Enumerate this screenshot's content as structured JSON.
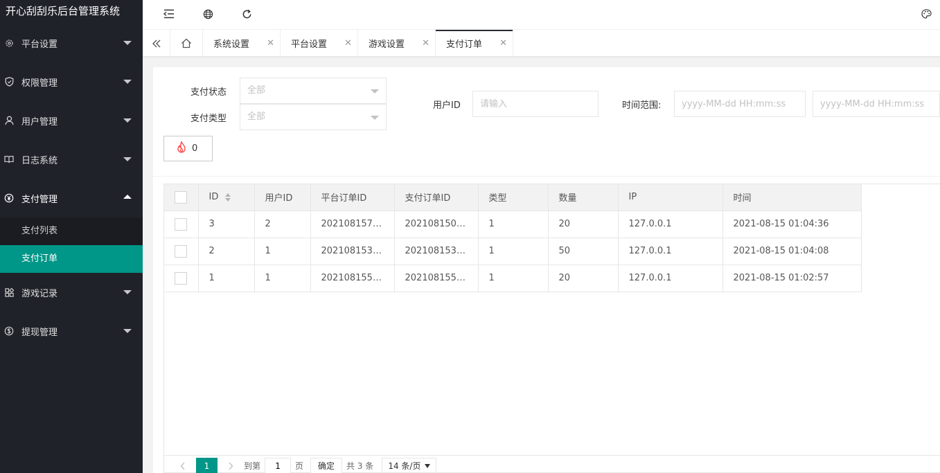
{
  "app": {
    "title": "开心刮刮乐后台管理系统"
  },
  "sidebar": {
    "items": [
      {
        "label": "平台设置",
        "icon": "gear-icon"
      },
      {
        "label": "权限管理",
        "icon": "shield-icon"
      },
      {
        "label": "用户管理",
        "icon": "user-icon"
      },
      {
        "label": "日志系统",
        "icon": "book-icon"
      },
      {
        "label": "支付管理",
        "icon": "yen-icon",
        "open": true,
        "children": [
          {
            "label": "支付列表"
          },
          {
            "label": "支付订单",
            "active": true
          }
        ]
      },
      {
        "label": "游戏记录",
        "icon": "apps-icon"
      },
      {
        "label": "提现管理",
        "icon": "dollar-icon"
      }
    ]
  },
  "tabs": [
    {
      "label": "系统设置"
    },
    {
      "label": "平台设置"
    },
    {
      "label": "游戏设置"
    },
    {
      "label": "支付订单",
      "active": true
    }
  ],
  "filters": {
    "pay_status_label": "支付状态",
    "pay_status_value": "全部",
    "pay_type_label": "支付类型",
    "pay_type_value": "全部",
    "user_id_label": "用户ID",
    "user_id_placeholder": "请输入",
    "time_range_label": "时间范围:",
    "time_start_placeholder": "yyyy-MM-dd HH:mm:ss",
    "time_end_placeholder": "yyyy-MM-dd HH:mm:ss",
    "hot_button_count": "0"
  },
  "table": {
    "columns": [
      "ID",
      "用户ID",
      "平台订单ID",
      "支付订单ID",
      "类型",
      "数量",
      "IP",
      "时间"
    ],
    "rows": [
      [
        "3",
        "2",
        "202108157…",
        "202108150…",
        "1",
        "20",
        "127.0.0.1",
        "2021-08-15 01:04:36"
      ],
      [
        "2",
        "1",
        "202108153…",
        "202108153…",
        "1",
        "50",
        "127.0.0.1",
        "2021-08-15 01:04:08"
      ],
      [
        "1",
        "1",
        "202108155…",
        "202108155…",
        "1",
        "20",
        "127.0.0.1",
        "2021-08-15 01:02:57"
      ]
    ]
  },
  "pagination": {
    "current_page": "1",
    "goto_label": "到第",
    "goto_value": "1",
    "page_unit": "页",
    "confirm_label": "确定",
    "total_label": "共 3 条",
    "page_size_label": "14 条/页"
  },
  "colors": {
    "accent": "#009688",
    "sidebar_bg": "#20222a"
  }
}
